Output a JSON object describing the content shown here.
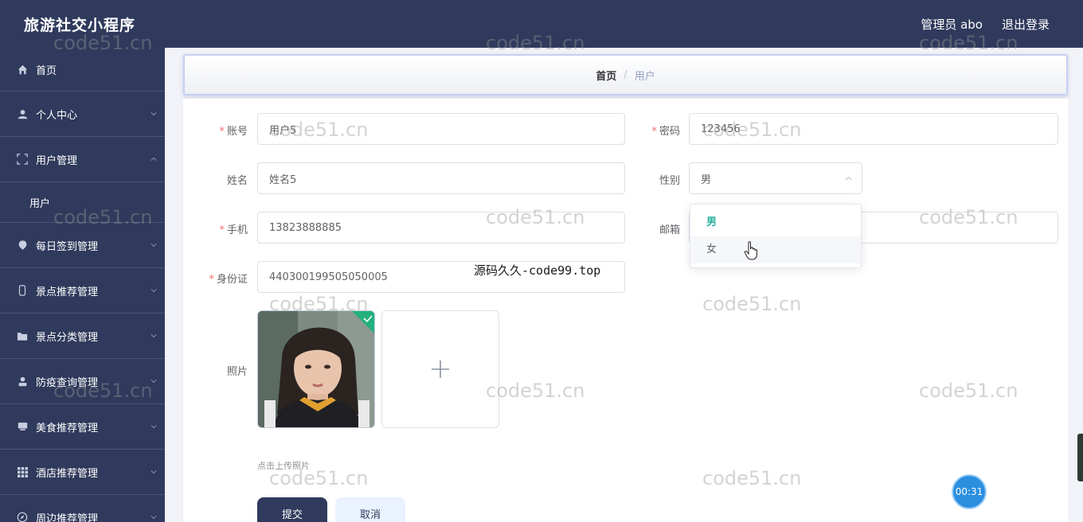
{
  "app": {
    "title": "旅游社交小程序"
  },
  "header": {
    "admin_label": "管理员 abo",
    "logout_label": "退出登录"
  },
  "sidebar": {
    "items": [
      {
        "label": "首页",
        "icon": "home-icon"
      },
      {
        "label": "个人中心",
        "icon": "user-icon"
      },
      {
        "label": "用户管理",
        "icon": "fullscreen-icon",
        "expanded": true
      },
      {
        "label": "用户",
        "sub": true
      },
      {
        "label": "每日签到管理",
        "icon": "location-icon"
      },
      {
        "label": "景点推荐管理",
        "icon": "phone-icon"
      },
      {
        "label": "景点分类管理",
        "icon": "folder-icon"
      },
      {
        "label": "防疫查询管理",
        "icon": "person-icon"
      },
      {
        "label": "美食推荐管理",
        "icon": "tray-icon"
      },
      {
        "label": "酒店推荐管理",
        "icon": "grid-icon"
      },
      {
        "label": "周边推荐管理",
        "icon": "compass-icon"
      }
    ]
  },
  "breadcrumb": {
    "home": "首页",
    "separator": "/",
    "current": "用户"
  },
  "form": {
    "account": {
      "label": "账号",
      "value": "用户5",
      "required": true
    },
    "password": {
      "label": "密码",
      "value": "123456",
      "required": true
    },
    "name": {
      "label": "姓名",
      "value": "姓名5"
    },
    "gender": {
      "label": "性别",
      "value": "男",
      "options": [
        "男",
        "女"
      ]
    },
    "phone": {
      "label": "手机",
      "value": "13823888885",
      "required": true
    },
    "email": {
      "label": "邮箱",
      "value": ""
    },
    "idcard": {
      "label": "身份证",
      "value": "440300199505050005",
      "required": true
    },
    "photo": {
      "label": "照片",
      "tip": "点击上传照片"
    },
    "submit_label": "提交",
    "cancel_label": "取消"
  },
  "overlay_text": "源码久久-code99.top",
  "watermark": "code51.cn",
  "timer": "00:31",
  "colors": {
    "primary": "#2f3a5c",
    "accent": "#29b3a0",
    "required": "#f56c6c"
  }
}
